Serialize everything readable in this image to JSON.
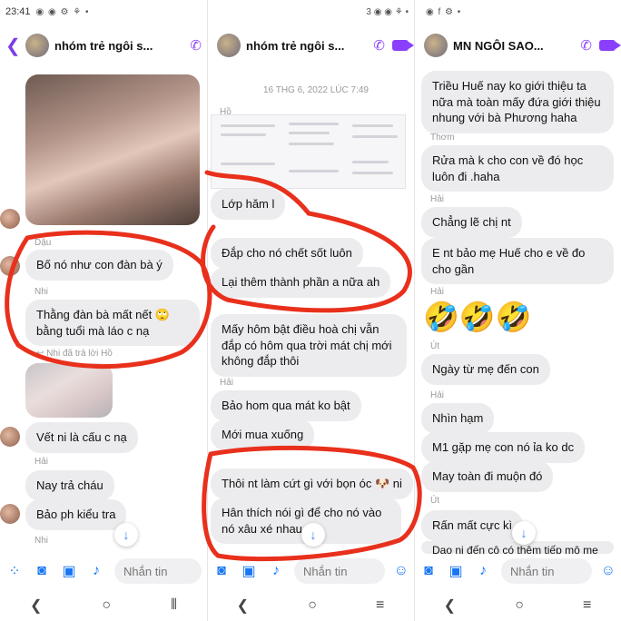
{
  "panels": [
    {
      "status": {
        "time": "23:41",
        "icons": "◉ ◉ ⚙ ⚘ •",
        "right": ""
      },
      "header": {
        "title": "nhóm trẻ ngôi s..."
      },
      "messages": [
        {
          "sender": "Dậu",
          "text": "Bố nó như con đàn bà ý"
        },
        {
          "sender": "Nhi",
          "text": "Thằng đàn bà mất nết 🙄 bằng tuổi mà láo c nạ"
        },
        {
          "reply_note": "↩ Nhi đã trả lời Hồ"
        },
        {
          "text": "Vết ni là cấu c nạ"
        },
        {
          "sender": "Hải",
          "text": "Nay trả cháu"
        },
        {
          "text": "Bảo ph kiểu tra"
        },
        {
          "sender": "Nhi"
        }
      ],
      "composer_placeholder": "Nhắn tin"
    },
    {
      "status": {
        "time": "",
        "icons": "",
        "right": "3  ◉ ◉ ⚘ •"
      },
      "header": {
        "title": "nhóm trẻ ngôi s..."
      },
      "date": "16 THG 6, 2022 LÚC 7:49",
      "messages": [
        {
          "sender": "Hồ"
        },
        {
          "text": "Lớp hăm l"
        },
        {
          "text": "Đắp cho nó chết sốt luôn"
        },
        {
          "text": "Lại thêm thành phần a nữa ah"
        },
        {
          "text": "Mấy hôm bật điều hoà chị vẫn đắp có hôm qua trời mát chị mới không đắp thôi"
        },
        {
          "sender": "Hải",
          "text": "Bảo hom qua mát ko bật"
        },
        {
          "text": "Mới mua xuống"
        },
        {
          "text": "Thôi nt làm cứt gì với bọn óc 🐶 ni"
        },
        {
          "text": "Hân thích nói gì để cho nó vào nó xâu xé nhau"
        }
      ],
      "composer_placeholder": "Nhắn tin"
    },
    {
      "status": {
        "time": "",
        "icons": "◉ f ⚙ •",
        "right": ""
      },
      "header": {
        "title": "MN NGÔI SAO..."
      },
      "messages": [
        {
          "text": "Triều Huế nay ko giới thiệu ta nữa mà toàn mấy đứa giới thiệu nhung với bà Phương haha"
        },
        {
          "sender": "Thơm",
          "text": "Rửa mà k cho con về đó học luôn đi .haha"
        },
        {
          "sender": "Hải",
          "text": "Chẳng lẽ chị nt"
        },
        {
          "text": "E nt bảo mẹ Huế cho e về đo cho gần"
        },
        {
          "sender": "Hải",
          "emoji": "🤣🤣🤣"
        },
        {
          "sender": "Út",
          "text": "Ngày từ mẹ đến con"
        },
        {
          "sender": "Hải",
          "text": "Nhìn hạm"
        },
        {
          "text": "M1 gặp mẹ con nó ỉa ko dc"
        },
        {
          "text": "May toàn đi muộn đó"
        },
        {
          "sender": "Út",
          "text": "Rấn mất cực kì"
        },
        {
          "text": "Dạo ni đến cô có thêm tiếp mô me"
        }
      ],
      "composer_placeholder": "Nhắn tin"
    }
  ],
  "colors": {
    "accent": "#8a3ffc",
    "blue": "#1877f2",
    "annotation": "#e8301c",
    "bubble": "#ececee"
  },
  "icons": [
    "back-arrow-icon",
    "phone-icon",
    "video-camera-icon",
    "grid-icon",
    "camera-icon",
    "image-icon",
    "microphone-icon",
    "emoji-icon",
    "scroll-down-icon",
    "nav-back-icon",
    "nav-home-icon",
    "nav-recents-icon"
  ]
}
